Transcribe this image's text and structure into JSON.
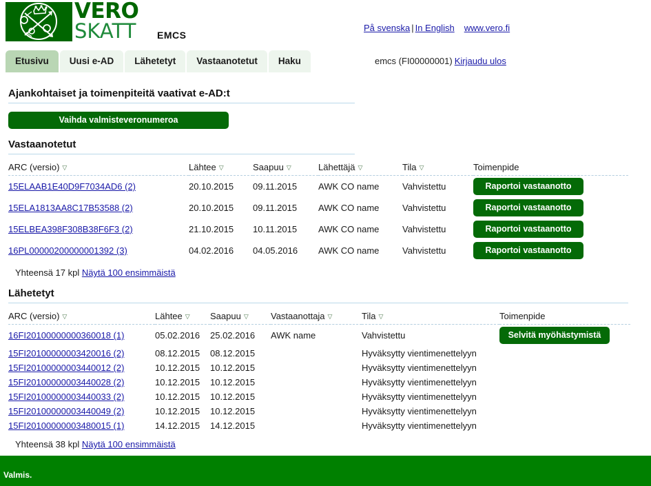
{
  "header": {
    "logo_vero": "VERO",
    "logo_skatt": "SKATT",
    "app_title": "EMCS",
    "links": {
      "swedish": "På svenska",
      "separator": "|",
      "english": "In English",
      "website": "www.vero.fi"
    },
    "user": {
      "account": "emcs (FI00000001)",
      "logout": "Kirjaudu ulos"
    }
  },
  "tabs": [
    {
      "label": "Etusivu",
      "active": true
    },
    {
      "label": "Uusi e-AD",
      "active": false
    },
    {
      "label": "Lähetetyt",
      "active": false
    },
    {
      "label": "Vastaanotetut",
      "active": false
    },
    {
      "label": "Haku",
      "active": false
    }
  ],
  "page": {
    "title": "Ajankohtaiset ja toimenpiteitä vaativat e-AD:t",
    "change_excise_number_button": "Vaihda valmisteveronumeroa"
  },
  "received": {
    "title": "Vastaanotetut",
    "columns": {
      "arc": "ARC (versio)",
      "departure": "Lähtee",
      "arrival": "Saapuu",
      "sender": "Lähettäjä",
      "state": "Tila",
      "action": "Toimenpide"
    },
    "rows": [
      {
        "arc": "15ELAAB1E40D9F7034AD6 (2)",
        "departure": "20.10.2015",
        "arrival": "09.11.2015",
        "sender": "AWK CO name",
        "state": "Vahvistettu",
        "action": "Raportoi vastaanotto"
      },
      {
        "arc": "15ELA1813AA8C17B53588 (2)",
        "departure": "20.10.2015",
        "arrival": "09.11.2015",
        "sender": "AWK CO name",
        "state": "Vahvistettu",
        "action": "Raportoi vastaanotto"
      },
      {
        "arc": "15ELBEA398F308B38F6F3 (2)",
        "departure": "21.10.2015",
        "arrival": "10.11.2015",
        "sender": "AWK CO name",
        "state": "Vahvistettu",
        "action": "Raportoi vastaanotto"
      },
      {
        "arc": "16PL00000200000001392 (3)",
        "departure": "04.02.2016",
        "arrival": "04.05.2016",
        "sender": "AWK CO name",
        "state": "Vahvistettu",
        "action": "Raportoi vastaanotto"
      }
    ],
    "total_prefix": "Yhteensä 17 kpl",
    "show_first_link": "Näytä 100 ensimmäistä"
  },
  "sent": {
    "title": "Lähetetyt",
    "columns": {
      "arc": "ARC (versio)",
      "departure": "Lähtee",
      "arrival": "Saapuu",
      "recipient": "Vastaanottaja",
      "state": "Tila",
      "action": "Toimenpide"
    },
    "rows": [
      {
        "arc": "16FI20100000000360018 (1)",
        "departure": "05.02.2016",
        "arrival": "25.02.2016",
        "recipient": "AWK name",
        "state": "Vahvistettu",
        "action": "Selvitä myöhästymistä"
      },
      {
        "arc": "15FI20100000003420016 (2)",
        "departure": "08.12.2015",
        "arrival": "08.12.2015",
        "recipient": "",
        "state": "Hyväksytty vientimenettelyyn",
        "action": ""
      },
      {
        "arc": "15FI20100000003440012 (2)",
        "departure": "10.12.2015",
        "arrival": "10.12.2015",
        "recipient": "",
        "state": "Hyväksytty vientimenettelyyn",
        "action": ""
      },
      {
        "arc": "15FI20100000003440028 (2)",
        "departure": "10.12.2015",
        "arrival": "10.12.2015",
        "recipient": "",
        "state": "Hyväksytty vientimenettelyyn",
        "action": ""
      },
      {
        "arc": "15FI20100000003440033 (2)",
        "departure": "10.12.2015",
        "arrival": "10.12.2015",
        "recipient": "",
        "state": "Hyväksytty vientimenettelyyn",
        "action": ""
      },
      {
        "arc": "15FI20100000003440049 (2)",
        "departure": "10.12.2015",
        "arrival": "10.12.2015",
        "recipient": "",
        "state": "Hyväksytty vientimenettelyyn",
        "action": ""
      },
      {
        "arc": "15FI20100000003480015 (1)",
        "departure": "14.12.2015",
        "arrival": "14.12.2015",
        "recipient": "",
        "state": "Hyväksytty vientimenettelyyn",
        "action": ""
      }
    ],
    "total_prefix": "Yhteensä 38 kpl",
    "show_first_link": "Näytä 100 ensimmäistä"
  },
  "footer": {
    "status": "Valmis."
  },
  "icons": {
    "sort_caret": "▽"
  },
  "colors": {
    "brand_green": "#006600",
    "button_green": "#046a07",
    "footer_green": "#008000",
    "link_blue": "#1919a8",
    "tab_active": "#b9d6b4",
    "tab_inactive": "#edf5ed",
    "rule_blue": "#b9d8ea"
  }
}
